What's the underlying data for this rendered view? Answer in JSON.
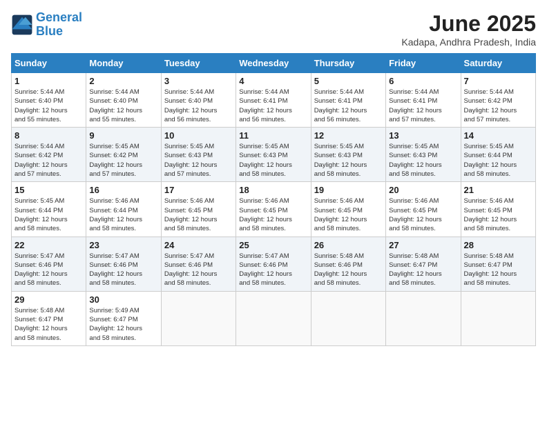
{
  "header": {
    "logo_line1": "General",
    "logo_line2": "Blue",
    "title": "June 2025",
    "subtitle": "Kadapa, Andhra Pradesh, India"
  },
  "calendar": {
    "days_of_week": [
      "Sunday",
      "Monday",
      "Tuesday",
      "Wednesday",
      "Thursday",
      "Friday",
      "Saturday"
    ],
    "weeks": [
      [
        {
          "day": "",
          "text": ""
        },
        {
          "day": "2",
          "text": "Sunrise: 5:44 AM\nSunset: 6:40 PM\nDaylight: 12 hours\nand 55 minutes."
        },
        {
          "day": "3",
          "text": "Sunrise: 5:44 AM\nSunset: 6:40 PM\nDaylight: 12 hours\nand 56 minutes."
        },
        {
          "day": "4",
          "text": "Sunrise: 5:44 AM\nSunset: 6:41 PM\nDaylight: 12 hours\nand 56 minutes."
        },
        {
          "day": "5",
          "text": "Sunrise: 5:44 AM\nSunset: 6:41 PM\nDaylight: 12 hours\nand 56 minutes."
        },
        {
          "day": "6",
          "text": "Sunrise: 5:44 AM\nSunset: 6:41 PM\nDaylight: 12 hours\nand 57 minutes."
        },
        {
          "day": "7",
          "text": "Sunrise: 5:44 AM\nSunset: 6:42 PM\nDaylight: 12 hours\nand 57 minutes."
        }
      ],
      [
        {
          "day": "1",
          "text": "Sunrise: 5:44 AM\nSunset: 6:40 PM\nDaylight: 12 hours\nand 55 minutes."
        },
        {
          "day": "",
          "text": ""
        },
        {
          "day": "",
          "text": ""
        },
        {
          "day": "",
          "text": ""
        },
        {
          "day": "",
          "text": ""
        },
        {
          "day": "",
          "text": ""
        },
        {
          "day": "",
          "text": ""
        }
      ],
      [
        {
          "day": "8",
          "text": "Sunrise: 5:44 AM\nSunset: 6:42 PM\nDaylight: 12 hours\nand 57 minutes."
        },
        {
          "day": "9",
          "text": "Sunrise: 5:45 AM\nSunset: 6:42 PM\nDaylight: 12 hours\nand 57 minutes."
        },
        {
          "day": "10",
          "text": "Sunrise: 5:45 AM\nSunset: 6:43 PM\nDaylight: 12 hours\nand 57 minutes."
        },
        {
          "day": "11",
          "text": "Sunrise: 5:45 AM\nSunset: 6:43 PM\nDaylight: 12 hours\nand 58 minutes."
        },
        {
          "day": "12",
          "text": "Sunrise: 5:45 AM\nSunset: 6:43 PM\nDaylight: 12 hours\nand 58 minutes."
        },
        {
          "day": "13",
          "text": "Sunrise: 5:45 AM\nSunset: 6:43 PM\nDaylight: 12 hours\nand 58 minutes."
        },
        {
          "day": "14",
          "text": "Sunrise: 5:45 AM\nSunset: 6:44 PM\nDaylight: 12 hours\nand 58 minutes."
        }
      ],
      [
        {
          "day": "15",
          "text": "Sunrise: 5:45 AM\nSunset: 6:44 PM\nDaylight: 12 hours\nand 58 minutes."
        },
        {
          "day": "16",
          "text": "Sunrise: 5:46 AM\nSunset: 6:44 PM\nDaylight: 12 hours\nand 58 minutes."
        },
        {
          "day": "17",
          "text": "Sunrise: 5:46 AM\nSunset: 6:45 PM\nDaylight: 12 hours\nand 58 minutes."
        },
        {
          "day": "18",
          "text": "Sunrise: 5:46 AM\nSunset: 6:45 PM\nDaylight: 12 hours\nand 58 minutes."
        },
        {
          "day": "19",
          "text": "Sunrise: 5:46 AM\nSunset: 6:45 PM\nDaylight: 12 hours\nand 58 minutes."
        },
        {
          "day": "20",
          "text": "Sunrise: 5:46 AM\nSunset: 6:45 PM\nDaylight: 12 hours\nand 58 minutes."
        },
        {
          "day": "21",
          "text": "Sunrise: 5:46 AM\nSunset: 6:45 PM\nDaylight: 12 hours\nand 58 minutes."
        }
      ],
      [
        {
          "day": "22",
          "text": "Sunrise: 5:47 AM\nSunset: 6:46 PM\nDaylight: 12 hours\nand 58 minutes."
        },
        {
          "day": "23",
          "text": "Sunrise: 5:47 AM\nSunset: 6:46 PM\nDaylight: 12 hours\nand 58 minutes."
        },
        {
          "day": "24",
          "text": "Sunrise: 5:47 AM\nSunset: 6:46 PM\nDaylight: 12 hours\nand 58 minutes."
        },
        {
          "day": "25",
          "text": "Sunrise: 5:47 AM\nSunset: 6:46 PM\nDaylight: 12 hours\nand 58 minutes."
        },
        {
          "day": "26",
          "text": "Sunrise: 5:48 AM\nSunset: 6:46 PM\nDaylight: 12 hours\nand 58 minutes."
        },
        {
          "day": "27",
          "text": "Sunrise: 5:48 AM\nSunset: 6:47 PM\nDaylight: 12 hours\nand 58 minutes."
        },
        {
          "day": "28",
          "text": "Sunrise: 5:48 AM\nSunset: 6:47 PM\nDaylight: 12 hours\nand 58 minutes."
        }
      ],
      [
        {
          "day": "29",
          "text": "Sunrise: 5:48 AM\nSunset: 6:47 PM\nDaylight: 12 hours\nand 58 minutes."
        },
        {
          "day": "30",
          "text": "Sunrise: 5:49 AM\nSunset: 6:47 PM\nDaylight: 12 hours\nand 58 minutes."
        },
        {
          "day": "",
          "text": ""
        },
        {
          "day": "",
          "text": ""
        },
        {
          "day": "",
          "text": ""
        },
        {
          "day": "",
          "text": ""
        },
        {
          "day": "",
          "text": ""
        }
      ]
    ]
  }
}
